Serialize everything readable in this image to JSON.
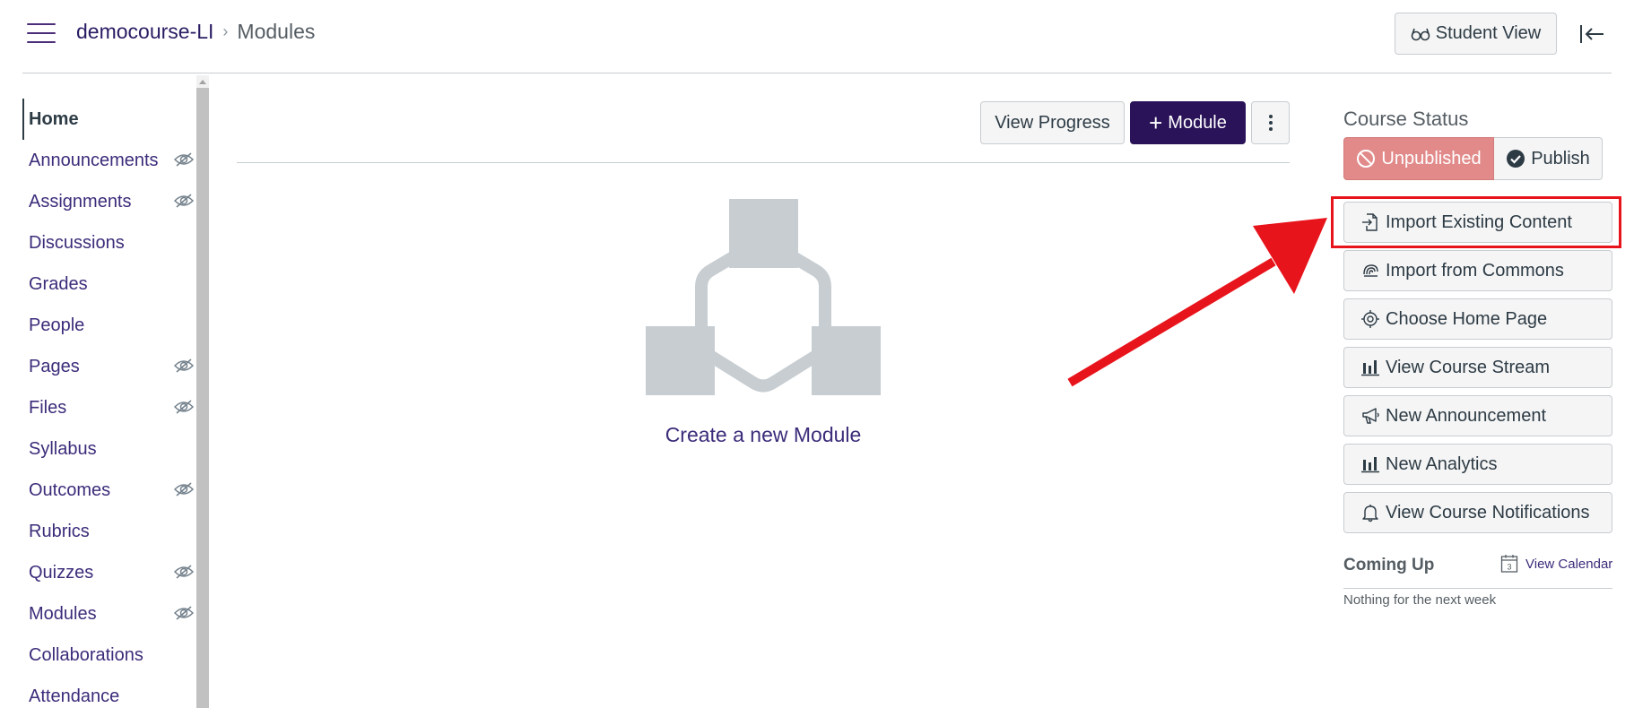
{
  "header": {
    "course_link": "democourse-LI",
    "separator": "›",
    "current_page": "Modules",
    "student_view_label": "Student View"
  },
  "nav": {
    "items": [
      {
        "label": "Home",
        "active": true,
        "hidden_icon": false
      },
      {
        "label": "Announcements",
        "active": false,
        "hidden_icon": true
      },
      {
        "label": "Assignments",
        "active": false,
        "hidden_icon": true
      },
      {
        "label": "Discussions",
        "active": false,
        "hidden_icon": false
      },
      {
        "label": "Grades",
        "active": false,
        "hidden_icon": false
      },
      {
        "label": "People",
        "active": false,
        "hidden_icon": false
      },
      {
        "label": "Pages",
        "active": false,
        "hidden_icon": true
      },
      {
        "label": "Files",
        "active": false,
        "hidden_icon": true
      },
      {
        "label": "Syllabus",
        "active": false,
        "hidden_icon": false
      },
      {
        "label": "Outcomes",
        "active": false,
        "hidden_icon": true
      },
      {
        "label": "Rubrics",
        "active": false,
        "hidden_icon": false
      },
      {
        "label": "Quizzes",
        "active": false,
        "hidden_icon": true
      },
      {
        "label": "Modules",
        "active": false,
        "hidden_icon": true
      },
      {
        "label": "Collaborations",
        "active": false,
        "hidden_icon": false
      },
      {
        "label": "Attendance",
        "active": false,
        "hidden_icon": false
      }
    ]
  },
  "toolbar": {
    "view_progress_label": "View Progress",
    "module_label": "Module",
    "module_plus": "+"
  },
  "main": {
    "create_module_label": "Create a new Module"
  },
  "sidebar": {
    "course_status_title": "Course Status",
    "unpublished_label": "Unpublished",
    "publish_label": "Publish",
    "actions": [
      {
        "label": "Import Existing Content",
        "icon": "import-icon"
      },
      {
        "label": "Import from Commons",
        "icon": "commons-icon"
      },
      {
        "label": "Choose Home Page",
        "icon": "target-icon"
      },
      {
        "label": "View Course Stream",
        "icon": "bar-chart-icon"
      },
      {
        "label": "New Announcement",
        "icon": "megaphone-icon"
      },
      {
        "label": "New Analytics",
        "icon": "bar-chart-icon"
      },
      {
        "label": "View Course Notifications",
        "icon": "bell-icon"
      }
    ],
    "coming_up_title": "Coming Up",
    "view_calendar_label": "View Calendar",
    "calendar_day": "3",
    "nothing_text": "Nothing for the next week"
  },
  "colors": {
    "brand_purple": "#2a1359",
    "link_purple": "#3c2c7a",
    "unpublished_red": "#e28a8a",
    "highlight_red": "#e8141c",
    "illustration_gray": "#c7cdd1"
  }
}
